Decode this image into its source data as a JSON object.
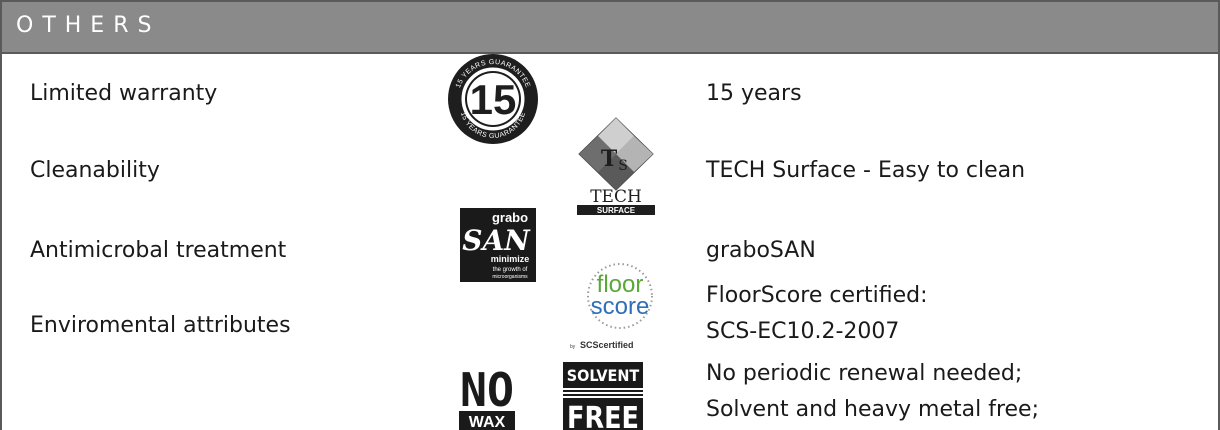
{
  "section": {
    "title": "OTHERS"
  },
  "rows": [
    {
      "label": "Limited warranty",
      "value": "15 years",
      "icon": "warranty-15-years-badge"
    },
    {
      "label": "Cleanability",
      "value": "TECH Surface - Easy to clean",
      "icon": "tech-surface-logo"
    },
    {
      "label": "Antimicrobal treatment",
      "value": "graboSAN",
      "icon": "grabosan-logo"
    },
    {
      "label": "Enviromental attributes",
      "value_lines": [
        "FloorScore certified:",
        "SCS-EC10.2-2007"
      ],
      "icon": "floorscore-logo"
    },
    {
      "label": "",
      "value_lines": [
        "No periodic renewal needed;",
        "Solvent and heavy metal free;"
      ],
      "icon": [
        "no-wax-logo",
        "solvent-free-logo"
      ]
    }
  ],
  "badges": {
    "warranty": {
      "number": "15",
      "ring_text": "15 YEARS GUARANTEE",
      "ring_text_bottom": "15 YEARS GUARANTEE"
    },
    "tech": {
      "t": "T",
      "s": "S",
      "line1": "TECH",
      "line2": "SURFACE"
    },
    "grabo": {
      "top": "grabo",
      "san": "SAN",
      "line1": "minimize",
      "line2": "the growth of",
      "line3": "microorganisms"
    },
    "floorscore": {
      "floor": "floor",
      "score": "score",
      "by": "by",
      "scs": "SCScertified"
    },
    "nowax": {
      "no": "NO",
      "wax": "WAX"
    },
    "solvent": {
      "top": "SOLVENT",
      "free": "FREE"
    }
  },
  "colors": {
    "header_bg": "#8a8a8a",
    "border": "#5a5a5a",
    "floor_green": "#5aa83a",
    "score_blue": "#2f6fb5"
  }
}
